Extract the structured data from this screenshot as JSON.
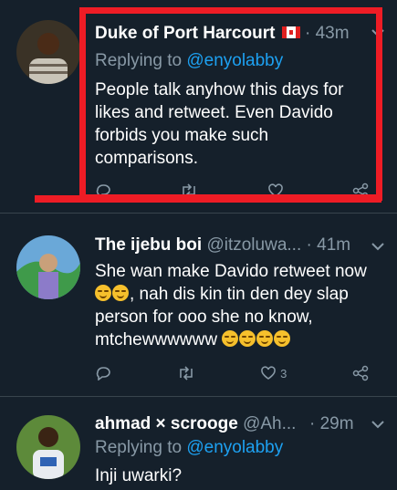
{
  "tweets": [
    {
      "name": "Duke of Port Harcourt",
      "time": "· 43m",
      "replying_prefix": "Replying to ",
      "replying_handle": "@enyolabby",
      "text_lines": [
        "People talk anyhow this days for",
        "likes and retweet. Even Davido",
        "forbids you make such",
        "comparisons."
      ],
      "flag_icon": "canada-flag-icon"
    },
    {
      "name": "The ijebu boi",
      "handle": "@itzoluwa...",
      "time": "· 41m",
      "text_line1": "She wan make Davido retweet now",
      "text_line2": ", nah dis kin tin den dey slap",
      "text_line3": "person for ooo she no know,",
      "text_line4": "mtchewwwwww",
      "likes": "3"
    },
    {
      "name": "ahmad × scrooge",
      "handle": "@Ah...",
      "time": "· 29m",
      "replying_prefix": "Replying to ",
      "replying_handle": "@enyolabby",
      "text": "Inji uwarki?"
    }
  ],
  "icons": {
    "reply": "reply-icon",
    "retweet": "retweet-icon",
    "like": "heart-icon",
    "share": "share-icon",
    "chevron": "chevron-down-icon"
  },
  "colors": {
    "background": "#15202b",
    "muted": "#8899a6",
    "link": "#1da1f2",
    "highlight": "#ee1c25"
  }
}
